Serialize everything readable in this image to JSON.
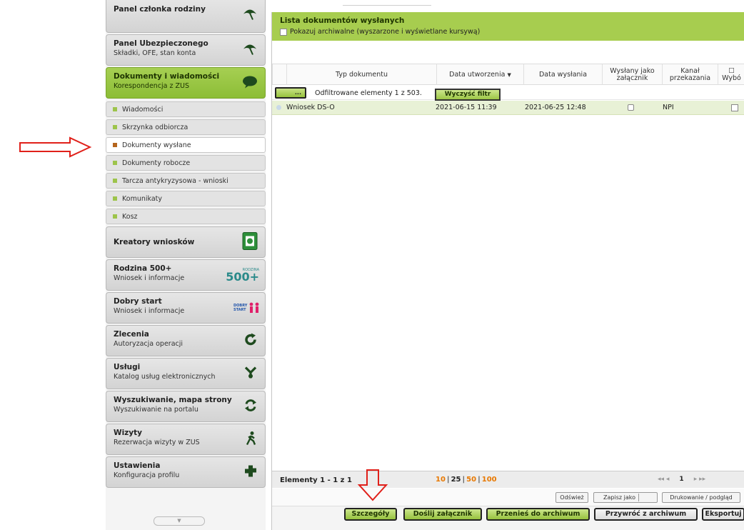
{
  "sidebar": {
    "panels": [
      {
        "title": "Panel członka rodziny",
        "subtitle": ""
      },
      {
        "title": "Panel Ubezpieczonego",
        "subtitle": "Składki, OFE, stan konta"
      },
      {
        "title": "Dokumenty i wiadomości",
        "subtitle": "Korespondencja z ZUS"
      }
    ],
    "subitems": [
      {
        "label": "Wiadomości"
      },
      {
        "label": "Skrzynka odbiorcza"
      },
      {
        "label": "Dokumenty wysłane"
      },
      {
        "label": "Dokumenty robocze"
      },
      {
        "label": "Tarcza antykryzysowa - wnioski"
      },
      {
        "label": "Komunikaty"
      },
      {
        "label": "Kosz"
      }
    ],
    "lower_panels": [
      {
        "title": "Kreatory wniosków",
        "subtitle": ""
      },
      {
        "title": "Rodzina 500+",
        "subtitle": "Wniosek i informacje",
        "badge": "500+",
        "badge_small": "RODZINA"
      },
      {
        "title": "Dobry start",
        "subtitle": "Wniosek i informacje",
        "badge": "DOBRY START"
      },
      {
        "title": "Zlecenia",
        "subtitle": "Autoryzacja operacji"
      },
      {
        "title": "Usługi",
        "subtitle": "Katalog usług elektronicznych"
      },
      {
        "title": "Wyszukiwanie, mapa strony",
        "subtitle": "Wyszukiwanie na portalu"
      },
      {
        "title": "Wizyty",
        "subtitle": "Rezerwacja wizyty w ZUS"
      },
      {
        "title": "Ustawienia",
        "subtitle": "Konfiguracja profilu"
      }
    ],
    "scroll_glyph": "▼"
  },
  "list": {
    "title": "Lista dokumentów wysłanych",
    "archive_label": "Pokazuj archiwalne (wyszarzone i wyświetlane kursywą)",
    "columns": {
      "type": "Typ dokumentu",
      "created": "Data utworzenia",
      "sort_mark": "▼",
      "sent": "Data wysłania",
      "attachment_1": "Wysłany jako",
      "attachment_2": "załącznik",
      "channel_1": "Kanał",
      "channel_2": "przekazania",
      "select_1": "☐",
      "select_2": "Wybó"
    },
    "filter_btn": "...",
    "filter_text": "Odfiltrowane elementy 1 z 503.",
    "clear_filter": "Wyczyść filtr",
    "row": {
      "type": "Wniosek DS-O",
      "created": "2021-06-15 11:39",
      "sent": "2021-06-25 12:48",
      "channel": "NPI"
    },
    "footer": {
      "elements": "Elementy 1 - 1 z 1",
      "page_sizes": [
        "10",
        "25",
        "50",
        "100"
      ],
      "sep": "|",
      "first": "◂◂ ◂",
      "page": "1",
      "last": "▸ ▸▸"
    },
    "row1_buttons": {
      "refresh": "Odśwież",
      "save_as": "Zapisz jako",
      "print": "Drukowanie / podgląd"
    },
    "row2_buttons": {
      "details": "Szczegóły",
      "send_attachment": "Doślij załącznik",
      "to_archive": "Przenieś do archiwum",
      "from_archive": "Przywróć z archiwum",
      "export": "Eksportuj"
    }
  },
  "colors": {
    "accent_green": "#8cbd36",
    "header_green": "#a7cd4f",
    "arrow_red": "#e0201a"
  }
}
